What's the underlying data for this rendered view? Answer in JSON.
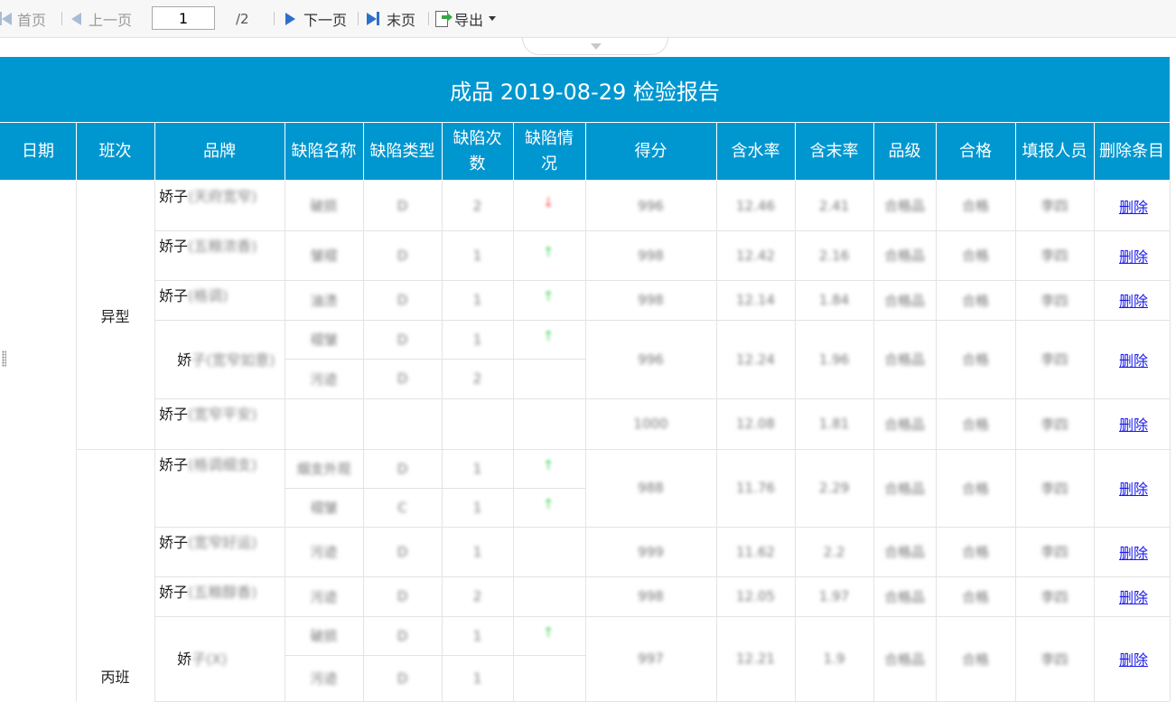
{
  "toolbar": {
    "first_page": "首页",
    "prev_page": "上一页",
    "current_page": "1",
    "total_pages": "/2",
    "next_page": "下一页",
    "last_page": "末页",
    "export": "导出"
  },
  "report": {
    "title": "成品 2019-08-29 检验报告",
    "headers": [
      "日期",
      "班次",
      "品牌",
      "缺陷名称",
      "缺陷类型",
      "缺陷次数",
      "缺陷情况",
      "得分",
      "含水率",
      "含末率",
      "品级",
      "合格",
      "填报人员",
      "删除条目"
    ],
    "shifts": [
      "异型",
      "丙班"
    ],
    "rows": [
      {
        "brand_prefix": "娇子",
        "brand_rest": "(天府宽窄)",
        "defects": [
          {
            "name": "破损",
            "type": "D",
            "count": "2",
            "trend": "down"
          }
        ],
        "score": "996",
        "moisture": "12.46",
        "dust": "2.41",
        "grade": "合格品",
        "pass": "合格",
        "reporter": "李四",
        "delete": "删除"
      },
      {
        "brand_prefix": "娇子",
        "brand_rest": "(五粮浓香)",
        "defects": [
          {
            "name": "皱褶",
            "type": "D",
            "count": "1",
            "trend": "up"
          }
        ],
        "score": "998",
        "moisture": "12.42",
        "dust": "2.16",
        "grade": "合格品",
        "pass": "合格",
        "reporter": "李四",
        "delete": "删除"
      },
      {
        "brand_prefix": "娇子",
        "brand_rest": "(格调)",
        "defects": [
          {
            "name": "油渍",
            "type": "D",
            "count": "1",
            "trend": "up"
          }
        ],
        "score": "998",
        "moisture": "12.14",
        "dust": "1.84",
        "grade": "合格品",
        "pass": "合格",
        "reporter": "李四",
        "delete": "删除"
      },
      {
        "brand_prefix": "娇",
        "brand_rest": "子(宽窄如意)",
        "defects": [
          {
            "name": "褶皱",
            "type": "D",
            "count": "1",
            "trend": "up"
          },
          {
            "name": "污迹",
            "type": "D",
            "count": "2",
            "trend": ""
          }
        ],
        "score": "996",
        "moisture": "12.24",
        "dust": "1.96",
        "grade": "合格品",
        "pass": "合格",
        "reporter": "李四",
        "delete": "删除"
      },
      {
        "brand_prefix": "娇子",
        "brand_rest": "(宽窄平安)",
        "defects": [],
        "score": "1000",
        "moisture": "12.08",
        "dust": "1.81",
        "grade": "合格品",
        "pass": "合格",
        "reporter": "李四",
        "delete": "删除"
      },
      {
        "brand_prefix": "娇子",
        "brand_rest": "(格调细支)",
        "defects": [
          {
            "name": "烟支外观",
            "type": "D",
            "count": "1",
            "trend": "up"
          },
          {
            "name": "褶皱",
            "type": "C",
            "count": "1",
            "trend": "up"
          }
        ],
        "score": "988",
        "moisture": "11.76",
        "dust": "2.29",
        "grade": "合格品",
        "pass": "合格",
        "reporter": "李四",
        "delete": "删除"
      },
      {
        "brand_prefix": "娇子",
        "brand_rest": "(宽窄好运)",
        "defects": [
          {
            "name": "污迹",
            "type": "D",
            "count": "1",
            "trend": ""
          }
        ],
        "score": "999",
        "moisture": "11.62",
        "dust": "2.2",
        "grade": "合格品",
        "pass": "合格",
        "reporter": "李四",
        "delete": "删除"
      },
      {
        "brand_prefix": "娇子",
        "brand_rest": "(五粮醇香)",
        "defects": [
          {
            "name": "污迹",
            "type": "D",
            "count": "2",
            "trend": ""
          }
        ],
        "score": "998",
        "moisture": "12.05",
        "dust": "1.97",
        "grade": "合格品",
        "pass": "合格",
        "reporter": "李四",
        "delete": "删除"
      },
      {
        "brand_prefix": "娇",
        "brand_rest": "子(X)",
        "defects": [
          {
            "name": "破损",
            "type": "D",
            "count": "1",
            "trend": "up"
          },
          {
            "name": "污迹",
            "type": "D",
            "count": "1",
            "trend": ""
          }
        ],
        "score": "997",
        "moisture": "12.21",
        "dust": "1.9",
        "grade": "合格品",
        "pass": "合格",
        "reporter": "李四",
        "delete": "删除"
      }
    ]
  },
  "colors": {
    "header_bg": "#0097d0",
    "link": "#1a1aee",
    "trend_up": "#3bd35a",
    "trend_down": "#ff4d4d"
  }
}
